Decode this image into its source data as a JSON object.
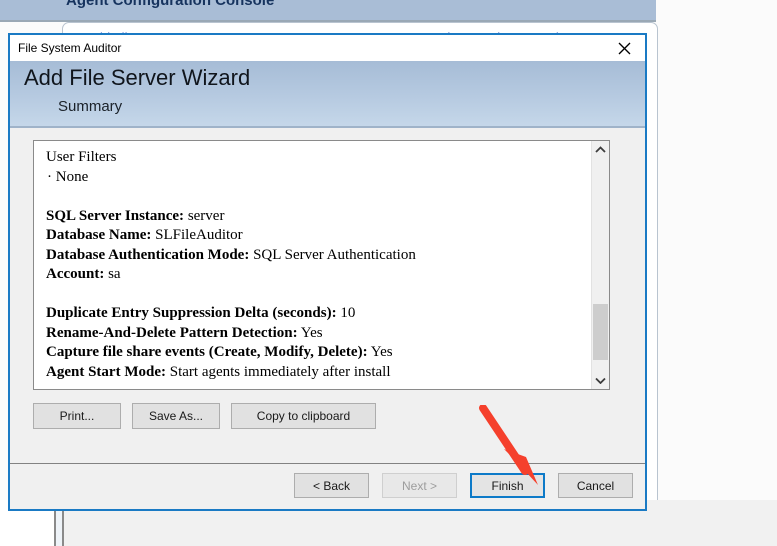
{
  "background": {
    "console_title": "Agent Configuration Console",
    "links": [
      {
        "label": "Add File Server",
        "icon": "server-icon"
      },
      {
        "label": "Launch Reporting Console",
        "icon": "document-icon"
      }
    ]
  },
  "dialog": {
    "window_title": "File System Auditor",
    "close_icon": "close-icon",
    "banner": {
      "title": "Add File Server Wizard",
      "subtitle": "Summary"
    },
    "summary": {
      "lines": [
        {
          "text": "User Filters",
          "bold": false,
          "style": "plain"
        },
        {
          "text": "· None",
          "bold": false,
          "style": "bullet"
        },
        {
          "text": "",
          "bold": false,
          "style": "blank"
        },
        {
          "label": "SQL Server Instance:",
          "value": "server",
          "style": "pair"
        },
        {
          "label": "Database Name:",
          "value": "SLFileAuditor",
          "style": "pair"
        },
        {
          "label": "Database Authentication Mode:",
          "value": "SQL Server Authentication",
          "style": "pair"
        },
        {
          "label": "Account:",
          "value": "sa",
          "style": "pair"
        },
        {
          "text": "",
          "bold": false,
          "style": "blank"
        },
        {
          "label": "Duplicate Entry Suppression Delta (seconds):",
          "value": "10",
          "style": "pair"
        },
        {
          "label": "Rename-And-Delete Pattern Detection:",
          "value": "Yes",
          "style": "pair"
        },
        {
          "label": "Capture file share events (Create, Modify, Delete):",
          "value": "Yes",
          "style": "pair"
        },
        {
          "label": "Agent Start Mode:",
          "value": "Start agents immediately after install",
          "style": "pair"
        }
      ],
      "scrollbar": {
        "up_icon": "chevron-up-icon",
        "down_icon": "chevron-down-icon",
        "thumb": "scroll-thumb"
      }
    },
    "actions": {
      "print_label": "Print...",
      "save_as_label": "Save As...",
      "copy_label": "Copy to clipboard"
    },
    "navigation": {
      "back_label": "< Back",
      "next_label": "Next >",
      "next_disabled": true,
      "finish_label": "Finish",
      "finish_focused": true,
      "cancel_label": "Cancel"
    }
  },
  "annotation": {
    "arrow_icon": "red-arrow-icon",
    "arrow_color": "#f5402c",
    "points_to": "Finish"
  },
  "colors": {
    "dialog_border": "#1a7ac4",
    "banner_top": "#a6bcd6",
    "banner_bottom": "#c6d8ea",
    "focus_blue": "#0d7ac8",
    "link_blue": "#1a3fbf",
    "annotation_red": "#f5402c"
  }
}
